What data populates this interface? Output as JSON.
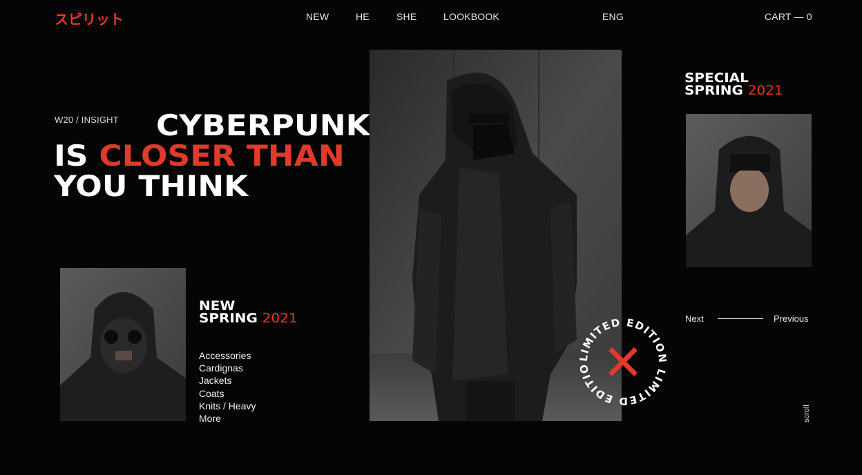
{
  "brand": {
    "logo": "スピリット"
  },
  "nav": {
    "items": [
      "NEW",
      "HE",
      "SHE",
      "LOOKBOOK"
    ],
    "language": "ENG",
    "cart": "CART — 0"
  },
  "hero": {
    "eyebrow": "W20 / INSIGHT",
    "line1": "CYBERPUNK",
    "line2_white": "IS",
    "line2_red": "CLOSER THAN",
    "line3": "YOU THINK"
  },
  "special": {
    "line1": "SPECIAL",
    "line2": "SPRING",
    "year": "2021"
  },
  "new_collection": {
    "line1": "NEW",
    "line2": "SPRING",
    "year": "2021",
    "categories": [
      "Accessories",
      "Cardignas",
      "Jackets",
      "Coats",
      "Knits / Heavy",
      "More"
    ]
  },
  "pager": {
    "next": "Next",
    "previous": "Previous"
  },
  "badge": {
    "text": "LIMITED EDITION LIMITED EDITION "
  },
  "scroll_label": "scroll",
  "colors": {
    "accent": "#e03a2a",
    "background": "#050505",
    "text": "#ffffff"
  },
  "icons": {
    "badge_mark": "x-mark-icon"
  }
}
